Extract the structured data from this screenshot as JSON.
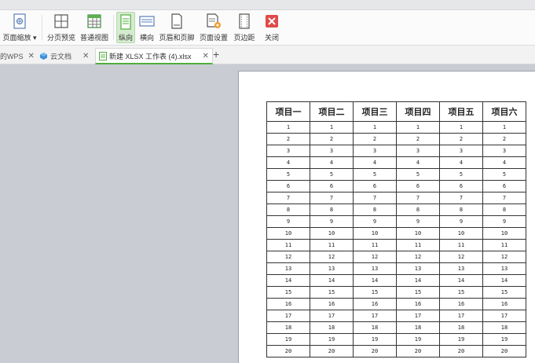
{
  "ribbon": {
    "page_scale": "页面缩放 ▾",
    "page_break_preview": "分页预览",
    "normal_view": "普通视图",
    "portrait": "纵向",
    "landscape": "横向",
    "header_footer": "页眉和页脚",
    "page_setup": "页面设置",
    "margins": "页边距",
    "close": "关闭"
  },
  "tabs": [
    {
      "label": "的WPS"
    },
    {
      "label": "云文档"
    },
    {
      "label": "新建 XLSX 工作表 (4).xlsx"
    }
  ],
  "table": {
    "headers": [
      "项目一",
      "项目二",
      "项目三",
      "项目四",
      "项目五",
      "项目六"
    ],
    "rows": [
      [
        "1",
        "1",
        "1",
        "1",
        "1",
        "1"
      ],
      [
        "2",
        "2",
        "2",
        "2",
        "2",
        "2"
      ],
      [
        "3",
        "3",
        "3",
        "3",
        "3",
        "3"
      ],
      [
        "4",
        "4",
        "4",
        "4",
        "4",
        "4"
      ],
      [
        "5",
        "5",
        "5",
        "5",
        "5",
        "5"
      ],
      [
        "6",
        "6",
        "6",
        "6",
        "6",
        "6"
      ],
      [
        "7",
        "7",
        "7",
        "7",
        "7",
        "7"
      ],
      [
        "8",
        "8",
        "8",
        "8",
        "8",
        "8"
      ],
      [
        "9",
        "9",
        "9",
        "9",
        "9",
        "9"
      ],
      [
        "10",
        "10",
        "10",
        "10",
        "10",
        "10"
      ],
      [
        "11",
        "11",
        "11",
        "11",
        "11",
        "11"
      ],
      [
        "12",
        "12",
        "12",
        "12",
        "12",
        "12"
      ],
      [
        "13",
        "13",
        "13",
        "13",
        "13",
        "13"
      ],
      [
        "14",
        "14",
        "14",
        "14",
        "14",
        "14"
      ],
      [
        "15",
        "15",
        "15",
        "15",
        "15",
        "15"
      ],
      [
        "16",
        "16",
        "16",
        "16",
        "16",
        "16"
      ],
      [
        "17",
        "17",
        "17",
        "17",
        "17",
        "17"
      ],
      [
        "18",
        "18",
        "18",
        "18",
        "18",
        "18"
      ],
      [
        "19",
        "19",
        "19",
        "19",
        "19",
        "19"
      ],
      [
        "20",
        "20",
        "20",
        "20",
        "20",
        "20"
      ]
    ]
  },
  "colors": {
    "accent_green": "#4fae3b",
    "close_red": "#e04a4a",
    "active_bg": "#d5ebcf"
  }
}
